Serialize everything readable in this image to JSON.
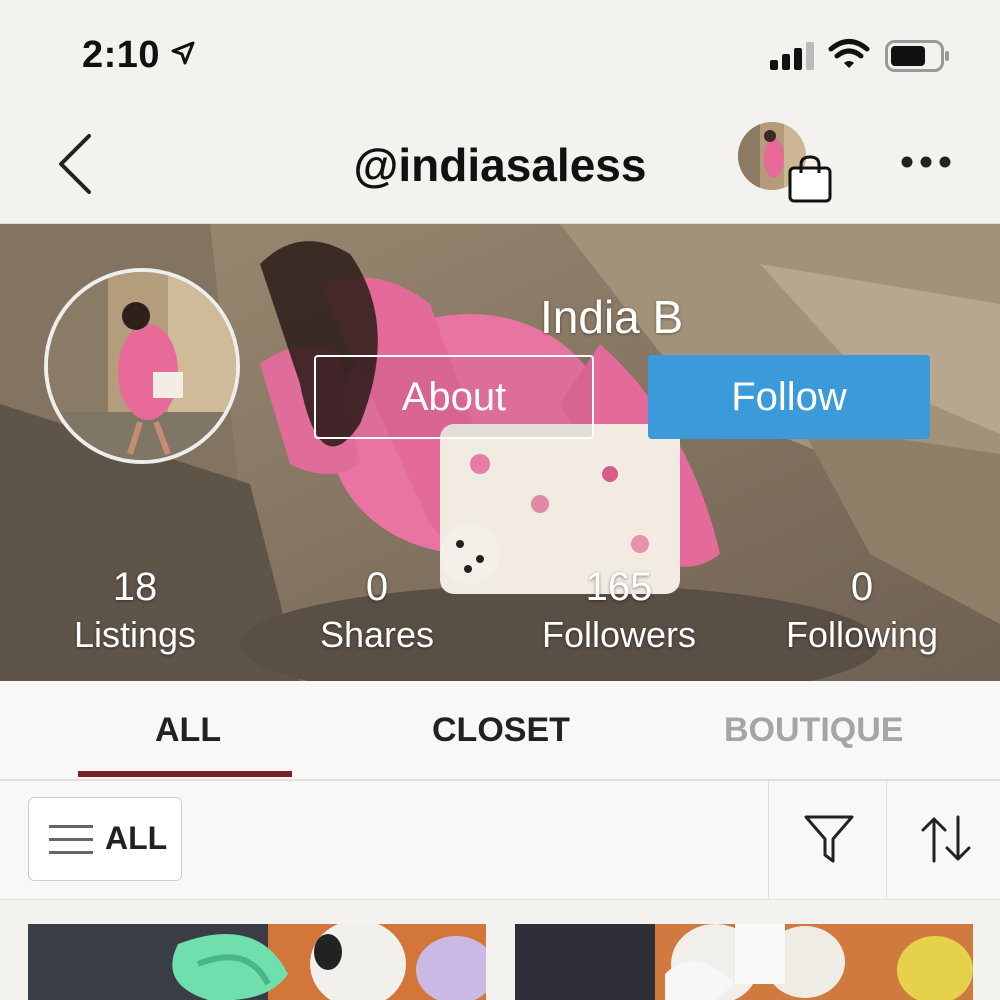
{
  "status_bar": {
    "time": "2:10",
    "icons": [
      "location-arrow-icon",
      "cellular-signal-icon",
      "wifi-icon",
      "battery-icon"
    ]
  },
  "header": {
    "username": "@indiasaless",
    "icons": [
      "back-chevron-icon",
      "shopping-bag-icon",
      "more-dots-icon"
    ]
  },
  "profile": {
    "display_name": "India B",
    "about_label": "About",
    "follow_label": "Follow",
    "follow_color": "#3b9ad9",
    "stats": [
      {
        "value": "18",
        "label": "Listings"
      },
      {
        "value": "0",
        "label": "Shares"
      },
      {
        "value": "165",
        "label": "Followers"
      },
      {
        "value": "0",
        "label": "Following"
      }
    ]
  },
  "tabs": {
    "items": [
      "ALL",
      "CLOSET",
      "BOUTIQUE"
    ],
    "active": "ALL",
    "accent_color": "#7e1f2e"
  },
  "filter_bar": {
    "category_label": "ALL",
    "icons": [
      "hamburger-menu-icon",
      "filter-funnel-icon",
      "sort-arrows-icon"
    ]
  }
}
